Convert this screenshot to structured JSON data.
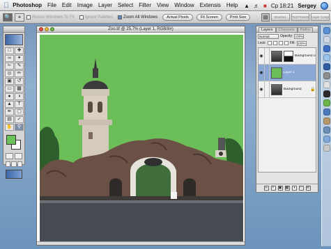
{
  "menubar": {
    "app": "Photoshop",
    "menus": [
      "File",
      "Edit",
      "Image",
      "Layer",
      "Select",
      "Filter",
      "View",
      "Window",
      "Extensis",
      "Help"
    ],
    "clock": "Cp 18:21",
    "user": "Sergey"
  },
  "options": {
    "items": [
      "Resize Windows To Fit",
      "Ignore Palettes",
      "Zoom All Windows"
    ],
    "buttons": [
      "Actual Pixels",
      "Fit Screen",
      "Print Size"
    ]
  },
  "palette_well": {
    "tabs": [
      "Brushes",
      "Tool Presets",
      "Layer Comps"
    ]
  },
  "document": {
    "title": "Zoo.tif @ 25,7% (Layer 1, RGB/8#)"
  },
  "layers_panel": {
    "tabs": [
      "Layers",
      "Channels",
      "Paths"
    ],
    "blend_mode": "Normal",
    "opacity_label": "Opacity:",
    "opacity_value": "100%",
    "lock_label": "Lock:",
    "fill_label": "Fill:",
    "fill_value": "100%",
    "layers": [
      {
        "name": "Background copy",
        "thumb": "photo",
        "has_mask": true,
        "selected": false,
        "locked": false
      },
      {
        "name": "Layer 1",
        "thumb": "green",
        "has_mask": false,
        "selected": true,
        "locked": false
      },
      {
        "name": "Background",
        "thumb": "photo",
        "has_mask": false,
        "selected": false,
        "locked": true
      }
    ]
  },
  "colors": {
    "foreground": "#6cbe58",
    "background": "#ffffff",
    "canvas_green": "#6cbe58",
    "selection": "#8aa8d6"
  },
  "icons": {
    "apple": "apple-icon",
    "eye": "eye-icon",
    "lock": "lock-icon",
    "help": "help-globe-icon"
  }
}
